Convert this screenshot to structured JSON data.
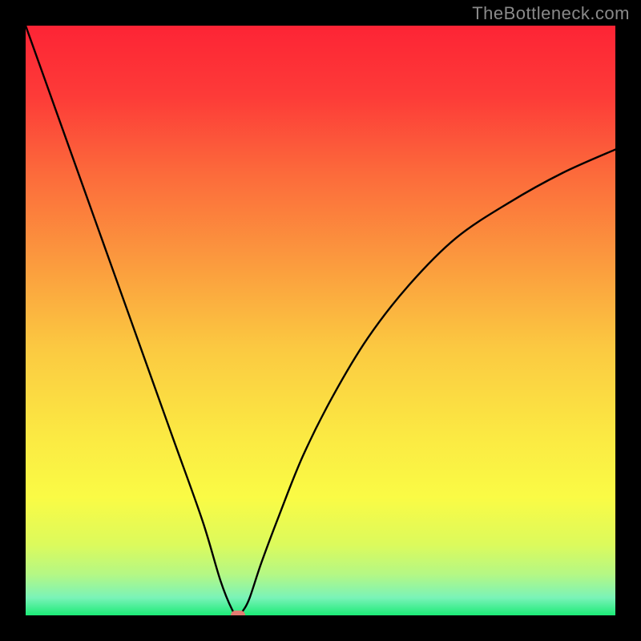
{
  "watermark": {
    "text": "TheBottleneck.com"
  },
  "colors": {
    "frame": "#000000",
    "curve": "#000000",
    "marker": "#e37c72",
    "gradient_stops": [
      {
        "offset": 0.0,
        "color": "#fd2435"
      },
      {
        "offset": 0.12,
        "color": "#fd3b38"
      },
      {
        "offset": 0.25,
        "color": "#fc6a3b"
      },
      {
        "offset": 0.4,
        "color": "#fb9a3e"
      },
      {
        "offset": 0.55,
        "color": "#fbca41"
      },
      {
        "offset": 0.7,
        "color": "#fbea43"
      },
      {
        "offset": 0.8,
        "color": "#fafb45"
      },
      {
        "offset": 0.88,
        "color": "#dcfa5c"
      },
      {
        "offset": 0.93,
        "color": "#b5f884"
      },
      {
        "offset": 0.97,
        "color": "#7af3b8"
      },
      {
        "offset": 1.0,
        "color": "#1ceb77"
      }
    ]
  },
  "chart_data": {
    "type": "line",
    "title": "",
    "xlabel": "",
    "ylabel": "",
    "xlim": [
      0,
      100
    ],
    "ylim": [
      0,
      100
    ],
    "series": [
      {
        "name": "bottleneck-curve",
        "x": [
          0,
          5,
          10,
          15,
          20,
          25,
          30,
          33,
          35,
          36,
          37,
          38,
          40,
          43,
          47,
          52,
          58,
          65,
          73,
          82,
          91,
          100
        ],
        "y": [
          100,
          86,
          72,
          58,
          44,
          30,
          16,
          6,
          1,
          0,
          1,
          3,
          9,
          17,
          27,
          37,
          47,
          56,
          64,
          70,
          75,
          79
        ]
      }
    ],
    "annotations": [
      {
        "name": "optimal-marker",
        "x": 36,
        "y": 0
      }
    ]
  }
}
